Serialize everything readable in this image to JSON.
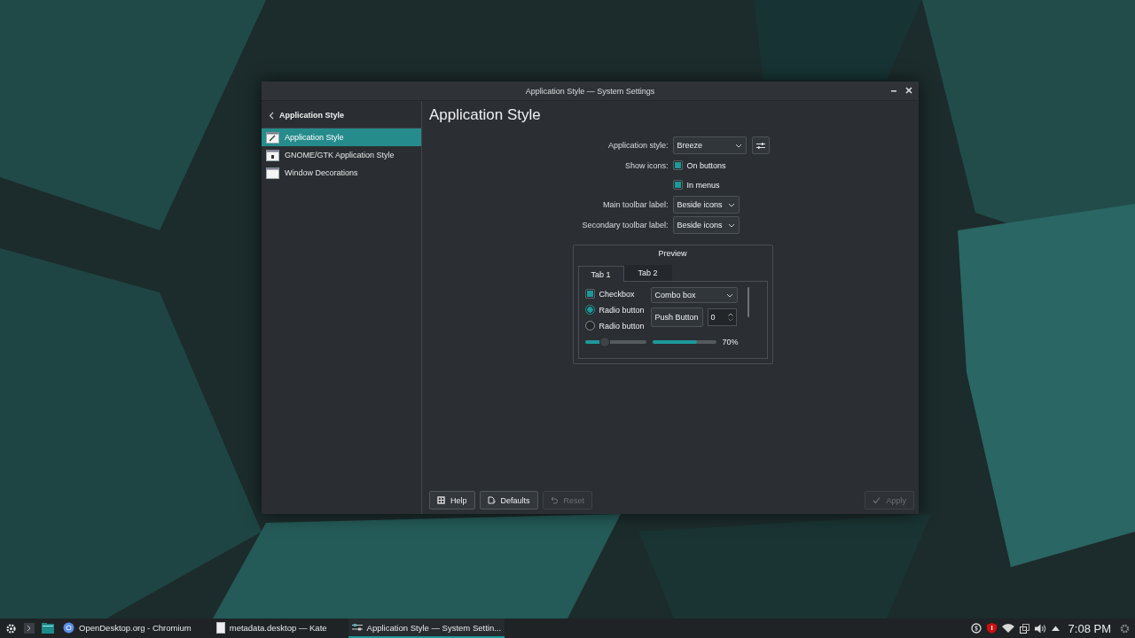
{
  "window": {
    "title": "Application Style — System Settings"
  },
  "sidebar": {
    "back_label": "Application Style",
    "items": [
      {
        "label": "Application Style",
        "selected": true,
        "kind": "style"
      },
      {
        "label": "GNOME/GTK Application Style",
        "selected": false,
        "kind": "gtk"
      },
      {
        "label": "Window Decorations",
        "selected": false,
        "kind": "window"
      }
    ]
  },
  "page": {
    "heading": "Application Style",
    "form": [
      {
        "kind": "combo",
        "label": "Application style:",
        "value": "Breeze",
        "configure_button": true
      },
      {
        "kind": "checkbox",
        "label": "Show icons:",
        "value": "On buttons",
        "checked": true
      },
      {
        "kind": "checkbox",
        "value": "In menus",
        "checked": true
      },
      {
        "kind": "combo",
        "label": "Main toolbar label:",
        "value": "Beside icons"
      },
      {
        "kind": "combo",
        "label": "Secondary toolbar label:",
        "value": "Beside icons"
      }
    ],
    "preview": {
      "title": "Preview",
      "tabs": [
        {
          "label": "Tab 1",
          "selected": true
        },
        {
          "label": "Tab 2",
          "selected": false
        }
      ],
      "checkbox": {
        "label": "Checkbox",
        "checked": true
      },
      "radios": [
        {
          "label": "Radio button",
          "selected": true
        },
        {
          "label": "Radio button",
          "selected": false
        }
      ],
      "combo": "Combo box",
      "push_button": "Push Button",
      "spin_value": "0",
      "slider": {
        "level": 0.33
      },
      "progress": {
        "level": 0.7,
        "reading": "70%"
      }
    },
    "buttons": [
      {
        "kind": "help",
        "label": "Help",
        "disabled": false
      },
      {
        "kind": "defaults",
        "label": "Defaults",
        "disabled": false
      },
      {
        "kind": "reset",
        "label": "Reset",
        "disabled": true
      },
      {
        "kind": "apply",
        "label": "Apply",
        "disabled": true
      }
    ]
  },
  "taskbar": {
    "tasks": [
      {
        "kind": "browser",
        "label": "OpenDesktop.org - Chromium",
        "selected": false
      },
      {
        "kind": "editor",
        "label": "metadata.desktop  — Kate",
        "selected": false
      },
      {
        "kind": "settings",
        "label": "Application Style  — System Settin...",
        "selected": true
      }
    ],
    "clock": "7:08 PM"
  }
}
